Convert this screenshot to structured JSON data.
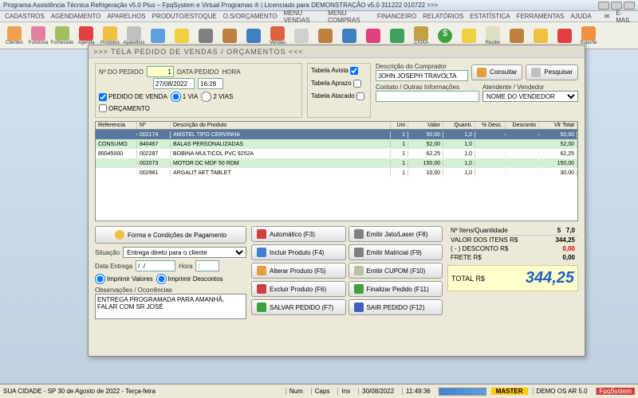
{
  "window": {
    "title": "Programa Assistência Técnica Refrigeração v5.0 Plus – FpqSystem e Virtual Programas ® | Licenciado para DEMONSTRAÇÃO v5.0 311222 010722 >>>"
  },
  "menu": [
    "CADASTROS",
    "AGENDAMENTO",
    "APARELHOS",
    "PRODUTO/ESTOQUE",
    "O.S/ORÇAMENTO",
    "MENU VENDAS",
    "MENU COMPRAS",
    "FINANCEIRO",
    "RELATÓRIOS",
    "ESTATÍSTICA",
    "FERRAMENTAS",
    "AJUDA",
    "E-MAIL"
  ],
  "toolbar": [
    "Clientes",
    "Funciona",
    "Fornecedo",
    "Agenda",
    "Produtos",
    "Aparelhos",
    "",
    "",
    "",
    "",
    "",
    "Vendas",
    "",
    "",
    "",
    "",
    "",
    "CAIXA",
    "",
    "",
    "Recibo",
    "",
    "",
    "",
    "Suporte"
  ],
  "dialog": {
    "title": ">>>  TELA PEDIDO DE VENDAS / ORÇAMENTOS  <<<",
    "labels": {
      "no_pedido": "Nº DO PEDIDO",
      "data_pedido": "DATA PEDIDO",
      "hora": "HORA",
      "pedido_venda": "PEDIDO DE VENDA",
      "orcamento": "ORÇAMENTO",
      "via1": "1 VIA",
      "via2": "2 VIAS",
      "tabela_avista": "Tabela Avista",
      "tabela_aprazo": "Tabela Aprazo",
      "tabela_atacado": "Tabela Atacado",
      "desc_comprador": "Descrição do Comprador",
      "contato": "Contato / Outras Informações",
      "atendente": "Atendente / Vendedor",
      "consultar": "Consultar",
      "pesquisar": "Pesquisar"
    },
    "values": {
      "no_pedido": "1",
      "data_pedido": "27/08/2022",
      "hora": "16:28",
      "comprador": "JOHN JOSEPH TRAVOLTA",
      "atendente": "NOME DO VENDEDOR"
    }
  },
  "grid": {
    "headers": [
      "Referencia",
      "Nº",
      "Descrição do Produto",
      "Uni",
      "Valor",
      "Quanti.",
      "% Desc.",
      "Desconto",
      "Vlr Total"
    ],
    "rows": [
      {
        "ref": "",
        "no": "002174",
        "desc": "AMSTEL TIPO CERVINHA",
        "uni": "1",
        "val": "50,00",
        "qt": "1,0",
        "pd": "",
        "dc": "",
        "tot": "50,00",
        "sel": true
      },
      {
        "ref": "CONSUMO",
        "no": "840467",
        "desc": "BALAS PERSONALIZADAS",
        "uni": "1",
        "val": "52,00",
        "qt": "1,0",
        "pd": "",
        "dc": "",
        "tot": "52,00"
      },
      {
        "ref": "85045000",
        "no": "002287",
        "desc": "BOBINA MULTICOL PVC 9252A",
        "uni": "1",
        "val": "62,25",
        "qt": "1,0",
        "pd": "",
        "dc": "",
        "tot": "62,25"
      },
      {
        "ref": "",
        "no": "002073",
        "desc": "MOTOR DC MDF 50 RDM",
        "uni": "1",
        "val": "150,00",
        "qt": "1,0",
        "pd": "",
        "dc": "",
        "tot": "150,00"
      },
      {
        "ref": "",
        "no": "002981",
        "desc": "ARGALIT AET TABLET",
        "uni": "1",
        "val": "10,00",
        "qt": "1,0",
        "pd": "",
        "dc": "",
        "tot": "30,00"
      }
    ]
  },
  "bottom": {
    "forma_pag": "Forma e Condições de Pagamento",
    "situacao_lbl": "Situação",
    "situacao": "Entrega direto para o cliente",
    "data_entrega_lbl": "Data Entrega",
    "data_entrega": "/  /",
    "hora_lbl": "Hora",
    "hora": ":",
    "imp_valores": "Imprimir Valores",
    "imp_desc": "Imprimir Descontos",
    "obs_lbl": "Observações / Ocorrências",
    "obs": "ENTREGA PROGRAMADA PARA AMANHÃ, FALAR COM SR JOSÉ"
  },
  "buttons": {
    "automatico": "Automático   (F3)",
    "incluir": "Incluir Produto (F4)",
    "alterar": "Alterar Produto (F5)",
    "excluir": "Excluir Produto (F6)",
    "salvar": "SALVAR PEDIDO (F7)",
    "jato": "Emitir Jato/Laser (F8)",
    "matricial": "Emitir Matricial (F9)",
    "cupom": "Emitir CUPOM  (F10)",
    "finalizar": "Finalizar Pedido (F11)",
    "sair": "SAIR  PEDIDO (F12)"
  },
  "totals": {
    "itens_lbl": "Nº Itens/Quantidade",
    "itens_n": "5",
    "itens_q": "7,0",
    "valor_lbl": "VALOR DOS ITENS R$",
    "valor": "344,25",
    "desc_lbl": "( - ) DESCONTO R$",
    "desc": "0,00",
    "frete_lbl": "FRETE          R$",
    "frete": "0,00",
    "total_lbl": "TOTAL R$",
    "total": "344,25"
  },
  "status": {
    "city": "SUA CIDADE - SP 30 de Agosto de 2022 - Terça-feira",
    "num": "Num",
    "caps": "Caps",
    "ins": "Ins",
    "date": "30/08/2022",
    "time": "11:49:36",
    "master": "MASTER",
    "demo": "DEMO OS AR 5.0",
    "fpq": "FpqSystem"
  }
}
